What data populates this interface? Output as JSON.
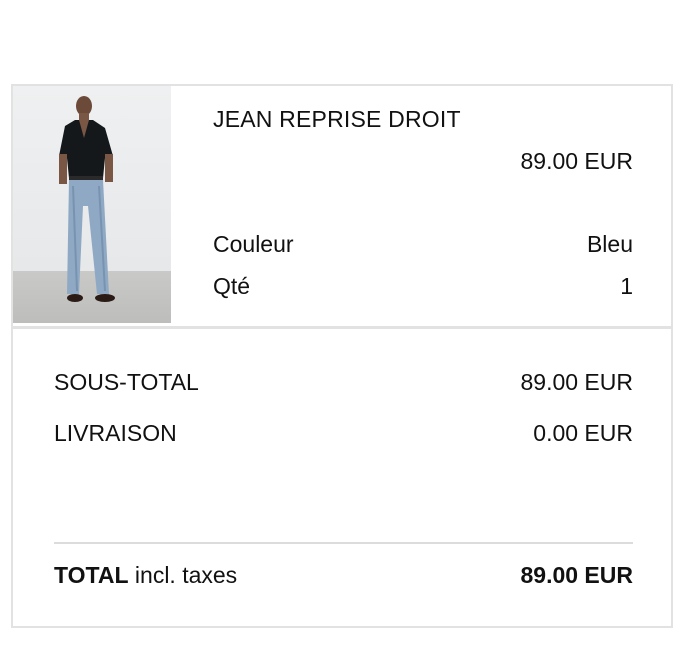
{
  "product": {
    "name": "JEAN REPRISE DROIT",
    "price": "89.00 EUR",
    "attributes": [
      {
        "label": "Couleur",
        "value": "Bleu"
      },
      {
        "label": "Qté",
        "value": "1"
      }
    ],
    "image_icon": "product-photo-model-jeans"
  },
  "summary": {
    "subtotal_label": "SOUS-TOTAL",
    "subtotal_value": "89.00 EUR",
    "shipping_label": "LIVRAISON",
    "shipping_value": "0.00 EUR",
    "total_label_bold": "TOTAL",
    "total_label_rest": " incl. taxes",
    "total_value": "89.00 EUR"
  },
  "colors": {
    "border": "#e2e2e2",
    "text": "#111111",
    "denim": "#8fa9c4",
    "shirt": "#15181b"
  }
}
